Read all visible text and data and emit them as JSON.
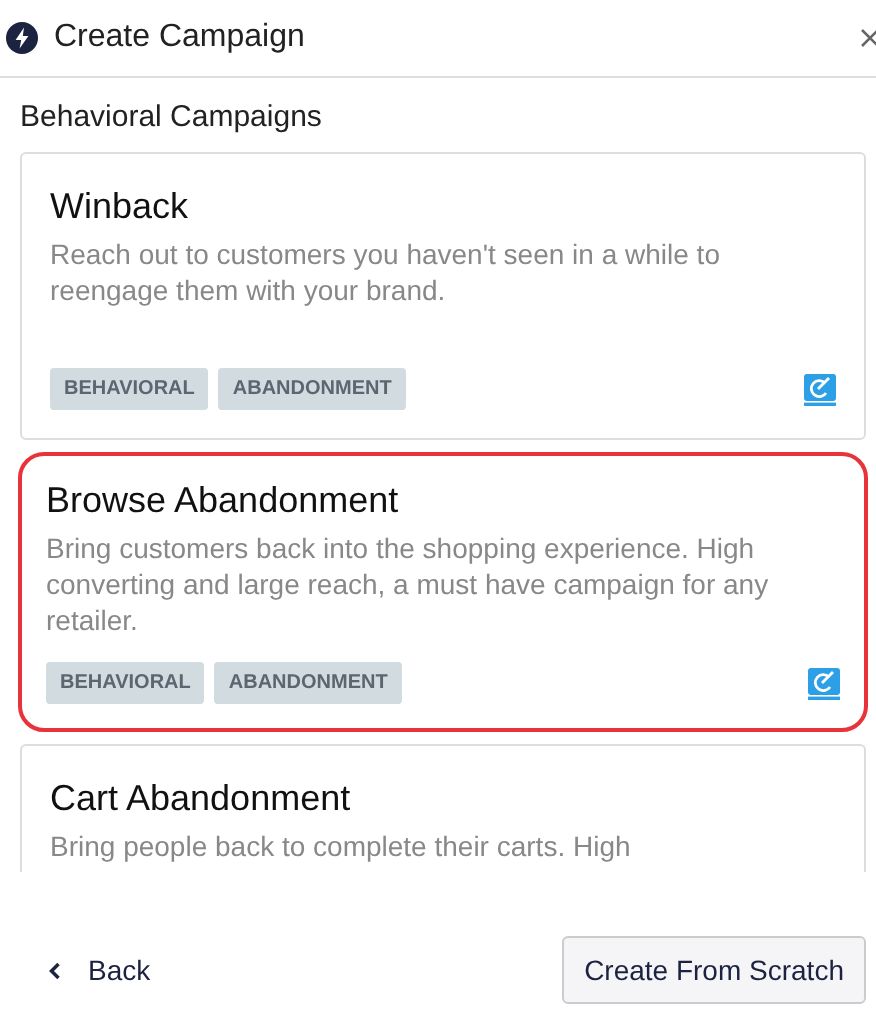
{
  "window": {
    "title": "Create Campaign"
  },
  "section_title": "Behavioral Campaigns",
  "campaigns": [
    {
      "title": "Winback",
      "description": "Reach out to customers you haven't seen in a while to reengage them with your brand.",
      "tags": [
        "BEHAVIORAL",
        "ABANDONMENT"
      ],
      "selected": false
    },
    {
      "title": "Browse Abandonment",
      "description": "Bring customers back into the shopping experience. High converting and large reach, a must have campaign for any retailer.",
      "tags": [
        "BEHAVIORAL",
        "ABANDONMENT"
      ],
      "selected": true
    },
    {
      "title": "Cart Abandonment",
      "description": "Bring people back to complete their carts. High",
      "selected": false
    }
  ],
  "footer": {
    "back": "Back",
    "create": "Create From Scratch"
  }
}
